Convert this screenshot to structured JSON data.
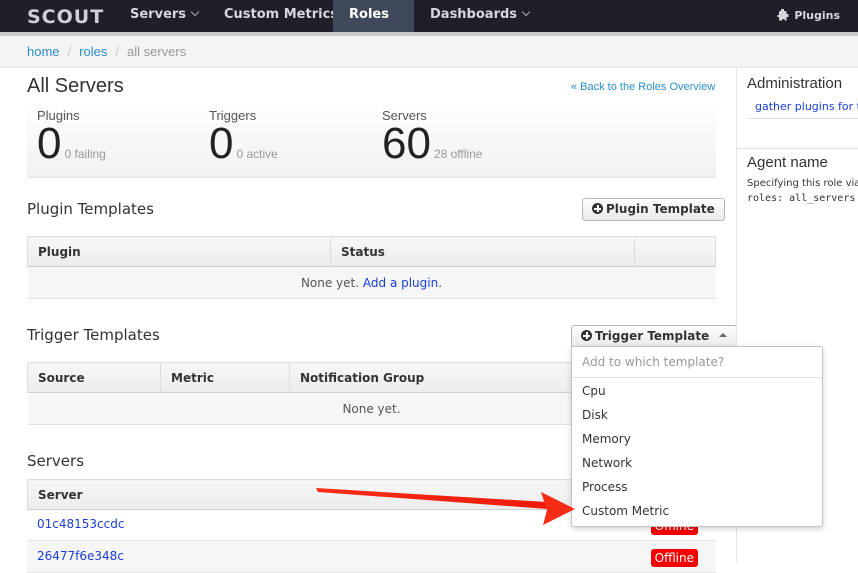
{
  "nav": {
    "logo": "SCOUT",
    "items": [
      {
        "label": "Servers",
        "has_menu": true
      },
      {
        "label": "Custom Metrics",
        "has_menu": false
      },
      {
        "label": "Roles",
        "has_menu": true,
        "active": true
      },
      {
        "label": "Dashboards",
        "has_menu": true
      }
    ],
    "plugins_label": "Plugins",
    "active_color": "#1ecf6e"
  },
  "breadcrumb": {
    "items": [
      "home",
      "roles"
    ],
    "current": "all servers"
  },
  "page": {
    "title": "All Servers",
    "back_link": "« Back to the Roles Overview"
  },
  "stats": [
    {
      "label": "Plugins",
      "value": "0",
      "sub": "0 failing"
    },
    {
      "label": "Triggers",
      "value": "0",
      "sub": "0 active"
    },
    {
      "label": "Servers",
      "value": "60",
      "sub": "28 offline"
    }
  ],
  "plugin_templates": {
    "heading": "Plugin Templates",
    "button": "Plugin Template",
    "columns": [
      "Plugin",
      "Status",
      ""
    ],
    "empty_text": "None yet.",
    "empty_link": "Add a plugin",
    "empty_suffix": "."
  },
  "trigger_templates": {
    "heading": "Trigger Templates",
    "button": "Trigger Template",
    "columns": [
      "Source",
      "Metric",
      "Notification Group"
    ],
    "empty_text": "None yet.",
    "dropdown": {
      "header": "Add to which template?",
      "options": [
        "Cpu",
        "Disk",
        "Memory",
        "Network",
        "Process",
        "Custom Metric"
      ]
    }
  },
  "servers": {
    "heading": "Servers",
    "column": "Server",
    "rows": [
      {
        "name": "01c48153ccdc",
        "status": "Offline"
      },
      {
        "name": "26477f6e348c",
        "status": "Offline"
      }
    ],
    "offline_color": "#f40000"
  },
  "sidebar": {
    "admin_heading": "Administration",
    "admin_link": "gather plugins for this role",
    "agent_heading": "Agent name",
    "agent_text": "Specifying this role via the agent:",
    "agent_code": "roles: all_servers"
  },
  "annotation": {
    "arrow_color": "#f52d17",
    "points_to": "Custom Metric"
  }
}
